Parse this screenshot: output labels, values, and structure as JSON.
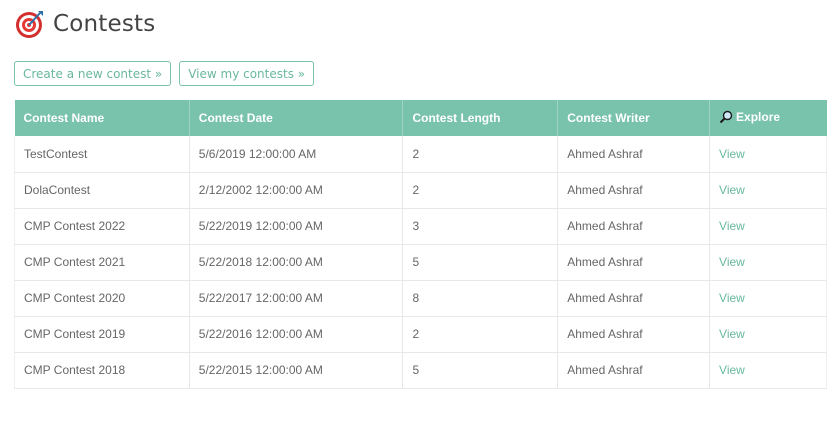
{
  "page": {
    "title": "Contests"
  },
  "actions": {
    "create_label": "Create a new contest »",
    "view_my_label": "View my contests »"
  },
  "table": {
    "headers": [
      "Contest Name",
      "Contest Date",
      "Contest Length",
      "Contest Writer",
      "Explore"
    ],
    "explore_icon": "magnifier-icon",
    "rows": [
      {
        "name": "TestContest",
        "date": "5/6/2019 12:00:00 AM",
        "length": "2",
        "writer": "Ahmed Ashraf",
        "link": "View"
      },
      {
        "name": "DolaContest",
        "date": "2/12/2002 12:00:00 AM",
        "length": "2",
        "writer": "Ahmed Ashraf",
        "link": "View"
      },
      {
        "name": "CMP Contest 2022",
        "date": "5/22/2019 12:00:00 AM",
        "length": "3",
        "writer": "Ahmed Ashraf",
        "link": "View"
      },
      {
        "name": "CMP Contest 2021",
        "date": "5/22/2018 12:00:00 AM",
        "length": "5",
        "writer": "Ahmed Ashraf",
        "link": "View"
      },
      {
        "name": "CMP Contest 2020",
        "date": "5/22/2017 12:00:00 AM",
        "length": "8",
        "writer": "Ahmed Ashraf",
        "link": "View"
      },
      {
        "name": "CMP Contest 2019",
        "date": "5/22/2016 12:00:00 AM",
        "length": "2",
        "writer": "Ahmed Ashraf",
        "link": "View"
      },
      {
        "name": "CMP Contest 2018",
        "date": "5/22/2015 12:00:00 AM",
        "length": "5",
        "writer": "Ahmed Ashraf",
        "link": "View"
      }
    ]
  },
  "colors": {
    "accent": "#79c2ab",
    "link": "#69b89e",
    "logo_red": "#e53935"
  }
}
